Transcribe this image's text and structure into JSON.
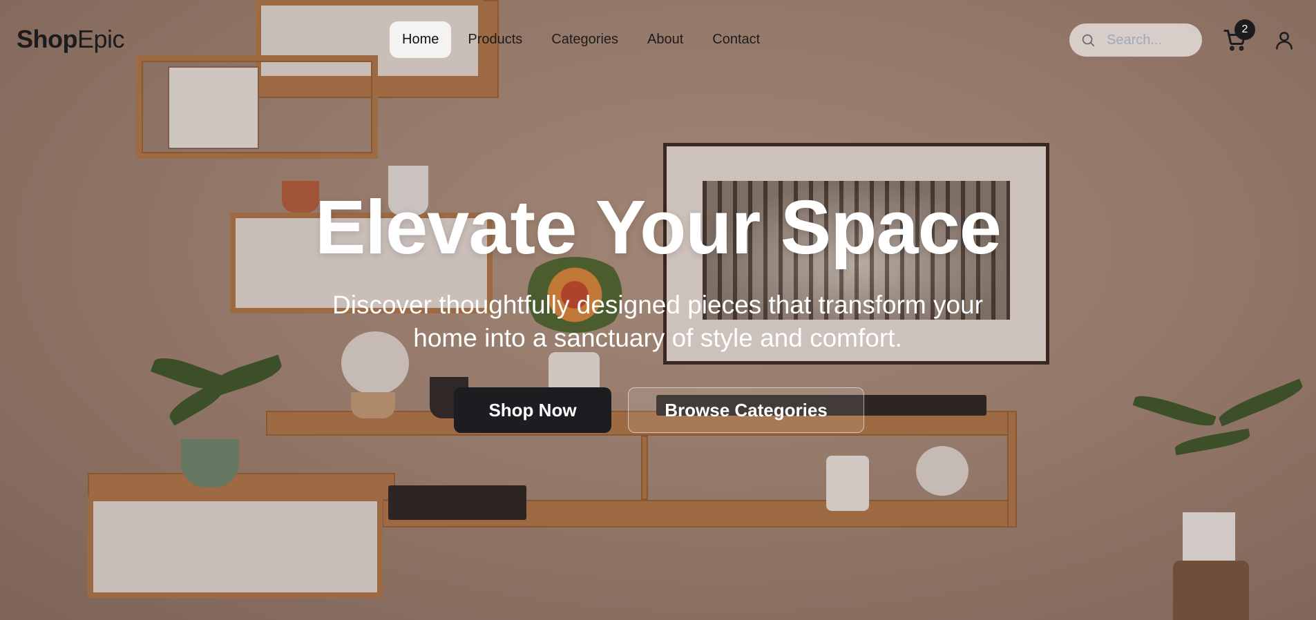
{
  "brand": {
    "bold": "Shop",
    "light": "Epic"
  },
  "nav": {
    "items": [
      {
        "label": "Home",
        "active": true
      },
      {
        "label": "Products",
        "active": false
      },
      {
        "label": "Categories",
        "active": false
      },
      {
        "label": "About",
        "active": false
      },
      {
        "label": "Contact",
        "active": false
      }
    ]
  },
  "search": {
    "placeholder": "Search...",
    "value": "",
    "icon": "search-icon"
  },
  "cart": {
    "count": "2",
    "icon": "cart-icon"
  },
  "user": {
    "icon": "user-icon"
  },
  "hero": {
    "title": "Elevate Your Space",
    "subtitle": "Discover thoughtfully designed pieces that transform your home into a sanctuary of style and comfort.",
    "primary_cta": "Shop Now",
    "secondary_cta": "Browse Categories"
  },
  "colors": {
    "primary_button": "#1d1c20",
    "active_nav_bg": "#f5f3f2",
    "text_light": "#ffffff"
  }
}
